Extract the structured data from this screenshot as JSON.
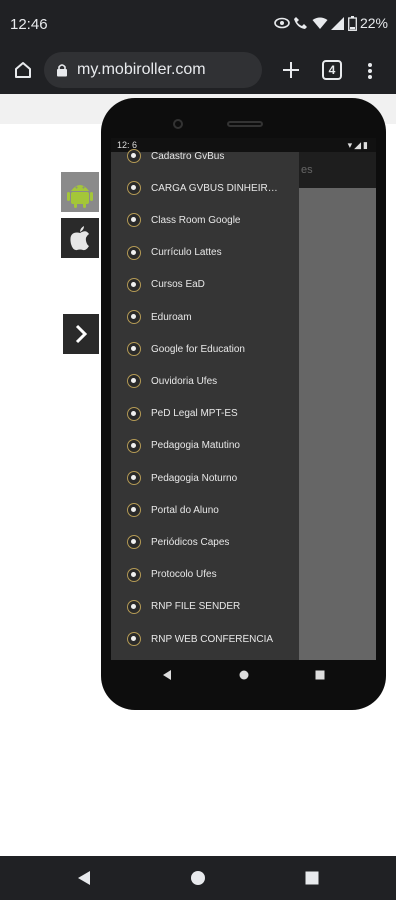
{
  "status_bar": {
    "time": "12:46",
    "battery": "22%"
  },
  "browser": {
    "url": "my.mobiroller.com",
    "tab_count": "4"
  },
  "phone": {
    "status_time": "12: 6",
    "header_text": "es",
    "drawer_items": [
      {
        "label": "Cadastro GvBus"
      },
      {
        "label": "CARGA GVBUS DINHEIRO/..."
      },
      {
        "label": "Class Room Google"
      },
      {
        "label": "Currículo Lattes"
      },
      {
        "label": "Cursos EaD"
      },
      {
        "label": "Eduroam"
      },
      {
        "label": "Google for Education"
      },
      {
        "label": "Ouvidoria Ufes"
      },
      {
        "label": "PeD Legal MPT-ES"
      },
      {
        "label": "Pedagogia Matutino"
      },
      {
        "label": "Pedagogia Noturno"
      },
      {
        "label": "Portal do Aluno"
      },
      {
        "label": "Periódicos Capes"
      },
      {
        "label": "Protocolo Ufes"
      },
      {
        "label": "RNP FILE SENDER"
      },
      {
        "label": "RNP WEB CONFERÊNCIA"
      }
    ]
  },
  "icons": {
    "home": "home-icon",
    "lock": "lock-icon",
    "new_tab": "plus-icon",
    "menu": "more-vert-icon",
    "android": "android-icon",
    "apple": "apple-icon",
    "next": "chevron-right-icon"
  },
  "colors": {
    "chrome_bg": "#202124",
    "drawer_bg": "#353535",
    "android_green": "#a4c639",
    "icon_ring": "#b49a55"
  }
}
